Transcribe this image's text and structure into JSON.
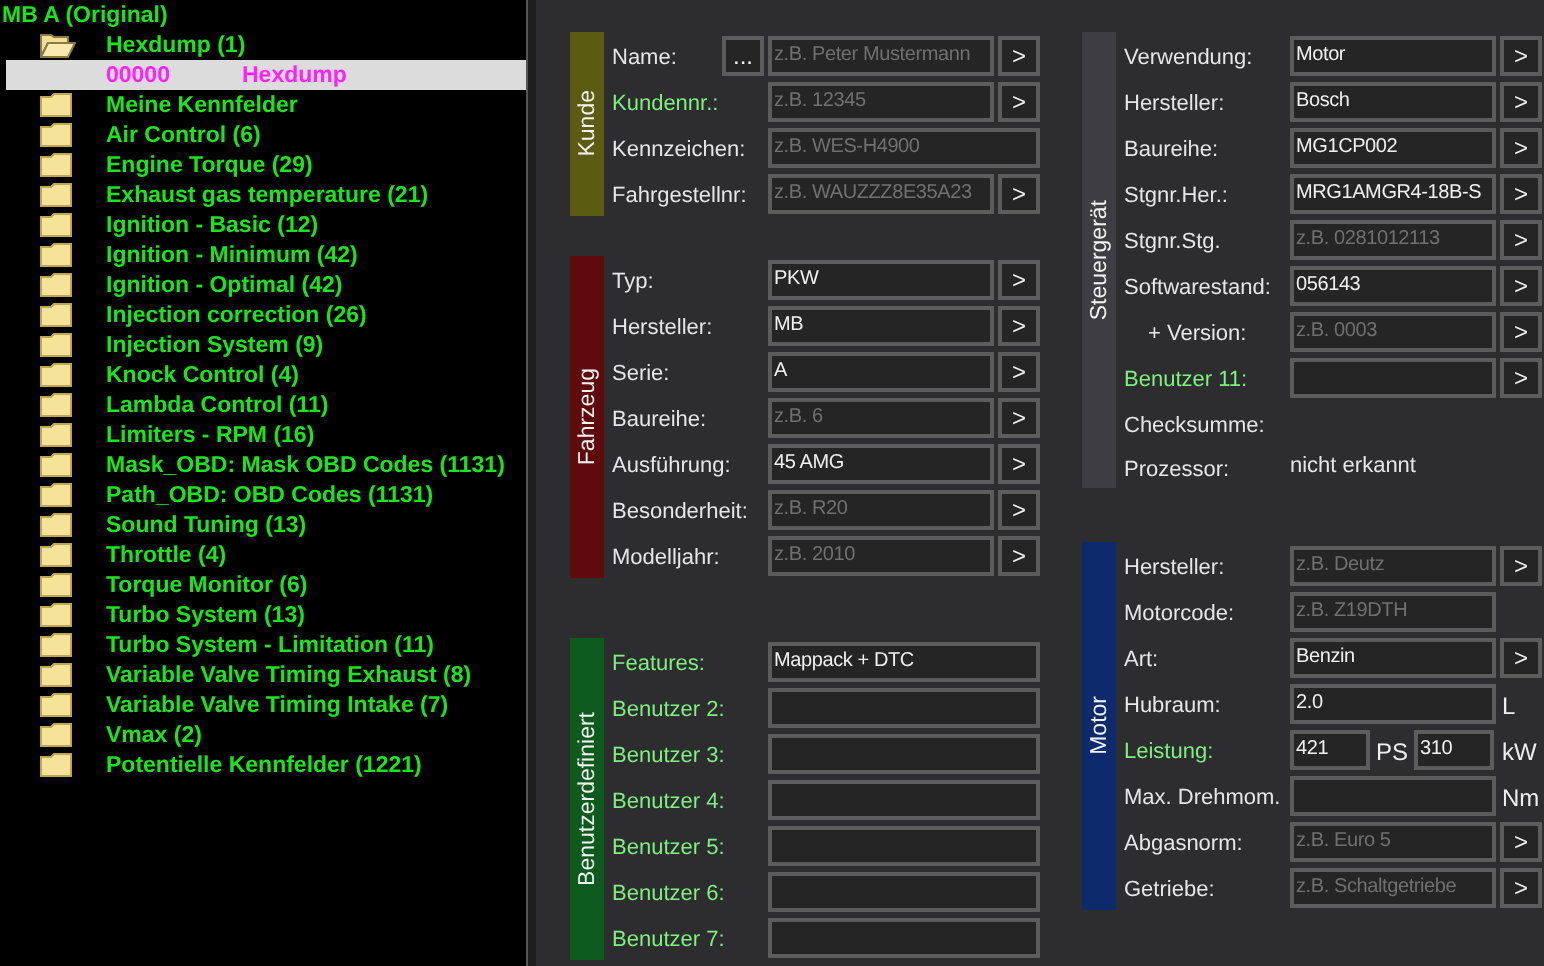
{
  "tree": {
    "label": "MB A (Original)",
    "children": [
      {
        "kind": "folder",
        "label": "Hexdump (1)",
        "expanded": true,
        "selected": false,
        "children": [
          {
            "kind": "entry",
            "code": "00000",
            "label": "Hexdump",
            "selected": true
          }
        ]
      },
      {
        "kind": "folder",
        "label": "Meine Kennfelder",
        "expanded": false,
        "selected": false
      },
      {
        "kind": "folder",
        "label": "Air Control (6)",
        "expanded": false,
        "selected": false
      },
      {
        "kind": "folder",
        "label": "Engine Torque (29)",
        "expanded": false,
        "selected": false
      },
      {
        "kind": "folder",
        "label": "Exhaust gas temperature (21)",
        "expanded": false,
        "selected": false
      },
      {
        "kind": "folder",
        "label": "Ignition - Basic (12)",
        "expanded": false,
        "selected": false
      },
      {
        "kind": "folder",
        "label": "Ignition - Minimum  (42)",
        "expanded": false,
        "selected": false
      },
      {
        "kind": "folder",
        "label": "Ignition - Optimal  (42)",
        "expanded": false,
        "selected": false
      },
      {
        "kind": "folder",
        "label": "Injection correction (26)",
        "expanded": false,
        "selected": false
      },
      {
        "kind": "folder",
        "label": "Injection System (9)",
        "expanded": false,
        "selected": false
      },
      {
        "kind": "folder",
        "label": "Knock Control (4)",
        "expanded": false,
        "selected": false
      },
      {
        "kind": "folder",
        "label": "Lambda Control (11)",
        "expanded": false,
        "selected": false
      },
      {
        "kind": "folder",
        "label": "Limiters - RPM  (16)",
        "expanded": false,
        "selected": false
      },
      {
        "kind": "folder",
        "label": "Mask_OBD: Mask OBD Codes (1131)",
        "expanded": false,
        "selected": false
      },
      {
        "kind": "folder",
        "label": "Path_OBD: OBD Codes (1131)",
        "expanded": false,
        "selected": false
      },
      {
        "kind": "folder",
        "label": "Sound Tuning (13)",
        "expanded": false,
        "selected": false
      },
      {
        "kind": "folder",
        "label": "Throttle  (4)",
        "expanded": false,
        "selected": false
      },
      {
        "kind": "folder",
        "label": "Torque Monitor  (6)",
        "expanded": false,
        "selected": false
      },
      {
        "kind": "folder",
        "label": "Turbo System (13)",
        "expanded": false,
        "selected": false
      },
      {
        "kind": "folder",
        "label": "Turbo System - Limitation (11)",
        "expanded": false,
        "selected": false
      },
      {
        "kind": "folder",
        "label": "Variable Valve Timing Exhaust (8)",
        "expanded": false,
        "selected": false
      },
      {
        "kind": "folder",
        "label": "Variable Valve Timing Intake (7)",
        "expanded": false,
        "selected": false
      },
      {
        "kind": "folder",
        "label": "Vmax (2)",
        "expanded": false,
        "selected": false
      },
      {
        "kind": "folder",
        "label": "Potentielle Kennfelder (1221)",
        "expanded": false,
        "selected": false
      }
    ]
  },
  "columns": [
    {
      "groups": [
        {
          "title": "Kunde",
          "color": "#5b5c12",
          "rows": [
            {
              "kind": "field",
              "label": "Name:",
              "highlighted": false,
              "pre_button": "...",
              "fields": [
                {
                  "placeholder": "z.B. Peter Mustermann"
                }
              ],
              "button": ">"
            },
            {
              "kind": "field",
              "label": "Kundennr.:",
              "highlighted": true,
              "fields": [
                {
                  "placeholder": "z.B. 12345"
                }
              ],
              "button": ">"
            },
            {
              "kind": "field",
              "label": "Kennzeichen:",
              "highlighted": false,
              "fields": [
                {
                  "placeholder": "z.B. WES-H4900"
                }
              ]
            },
            {
              "kind": "field",
              "label": "Fahrgestellnr:",
              "highlighted": false,
              "fields": [
                {
                  "placeholder": "z.B. WAUZZZ8E35A23"
                }
              ],
              "button": ">"
            }
          ]
        },
        {
          "title": "Fahrzeug",
          "color": "#5f0b0b",
          "rows": [
            {
              "kind": "field",
              "label": "Typ:",
              "highlighted": false,
              "fields": [
                {
                  "value": "PKW"
                }
              ],
              "button": ">"
            },
            {
              "kind": "field",
              "label": "Hersteller:",
              "highlighted": false,
              "fields": [
                {
                  "value": "MB"
                }
              ],
              "button": ">"
            },
            {
              "kind": "field",
              "label": "Serie:",
              "highlighted": false,
              "fields": [
                {
                  "value": "A"
                }
              ],
              "button": ">"
            },
            {
              "kind": "field",
              "label": "Baureihe:",
              "highlighted": false,
              "fields": [
                {
                  "placeholder": "z.B. 6"
                }
              ],
              "button": ">"
            },
            {
              "kind": "field",
              "label": "Ausführung:",
              "highlighted": false,
              "fields": [
                {
                  "value": "45 AMG"
                }
              ],
              "button": ">"
            },
            {
              "kind": "field",
              "label": "Besonderheit:",
              "highlighted": false,
              "fields": [
                {
                  "placeholder": "z.B. R20"
                }
              ],
              "button": ">"
            },
            {
              "kind": "field",
              "label": "Modelljahr:",
              "highlighted": false,
              "fields": [
                {
                  "placeholder": "z.B. 2010"
                }
              ],
              "button": ">"
            }
          ]
        },
        {
          "title": "Benutzerdefiniert",
          "color": "#0d5a1d",
          "rows": [
            {
              "kind": "field",
              "label": "Features:",
              "highlighted": true,
              "fields": [
                {
                  "value": "Mappack + DTC"
                }
              ]
            },
            {
              "kind": "field",
              "label": "Benutzer 2:",
              "highlighted": true
            },
            {
              "kind": "field",
              "label": "Benutzer 3:",
              "highlighted": true
            },
            {
              "kind": "field",
              "label": "Benutzer 4:",
              "highlighted": true
            },
            {
              "kind": "field",
              "label": "Benutzer 5:",
              "highlighted": true
            },
            {
              "kind": "field",
              "label": "Benutzer 6:",
              "highlighted": true
            },
            {
              "kind": "field",
              "label": "Benutzer 7:",
              "highlighted": true
            }
          ]
        }
      ]
    },
    {
      "groups": [
        {
          "title": "Steuergerät",
          "color": "#3e3e42",
          "rows": [
            {
              "kind": "field",
              "label": "Verwendung:",
              "highlighted": false,
              "fields": [
                {
                  "value": "Motor"
                }
              ],
              "button": ">"
            },
            {
              "kind": "field",
              "label": "Hersteller:",
              "highlighted": false,
              "fields": [
                {
                  "value": "Bosch"
                }
              ],
              "button": ">"
            },
            {
              "kind": "field",
              "label": "Baureihe:",
              "highlighted": false,
              "fields": [
                {
                  "value": "MG1CP002"
                }
              ],
              "button": ">"
            },
            {
              "kind": "field",
              "label": "Stgnr.Her.:",
              "highlighted": false,
              "fields": [
                {
                  "value": "MRG1AMGR4-18B-S"
                }
              ],
              "button": ">"
            },
            {
              "kind": "field",
              "label": "Stgnr.Stg.",
              "highlighted": false,
              "fields": [
                {
                  "placeholder": "z.B. 0281012113"
                }
              ],
              "button": ">"
            },
            {
              "kind": "field",
              "label": "Softwarestand:",
              "highlighted": false,
              "fields": [
                {
                  "value": "056143"
                }
              ],
              "button": ">"
            },
            {
              "kind": "field",
              "label": "+ Version:",
              "highlighted": false,
              "indented": true,
              "fields": [
                {
                  "placeholder": "z.B. 0003"
                }
              ],
              "button": ">"
            },
            {
              "kind": "field",
              "label": "Benutzer 11:",
              "highlighted": true,
              "button": ">"
            },
            {
              "kind": "text",
              "label": "Checksumme:",
              "highlighted": false
            },
            {
              "kind": "text",
              "label": "Prozessor:",
              "highlighted": false,
              "value": "nicht erkannt"
            }
          ]
        },
        {
          "title": "Motor",
          "color": "#0c2a6c",
          "rows": [
            {
              "kind": "field",
              "label": "Hersteller:",
              "highlighted": false,
              "fields": [
                {
                  "placeholder": "z.B. Deutz"
                }
              ],
              "button": ">"
            },
            {
              "kind": "field",
              "label": "Motorcode:",
              "highlighted": false,
              "fields": [
                {
                  "placeholder": "z.B. Z19DTH"
                }
              ]
            },
            {
              "kind": "field",
              "label": "Art:",
              "highlighted": false,
              "fields": [
                {
                  "value": "Benzin"
                }
              ],
              "button": ">"
            },
            {
              "kind": "field",
              "label": "Hubraum:",
              "highlighted": false,
              "fields": [
                {
                  "value": "2.0",
                  "unit": "L"
                }
              ]
            },
            {
              "kind": "field",
              "label": "Leistung:",
              "highlighted": true,
              "fields": [
                {
                  "value": "421",
                  "unit": "PS"
                },
                {
                  "value": "310",
                  "unit": "kW"
                }
              ]
            },
            {
              "kind": "field",
              "label": "Max. Drehmom.",
              "highlighted": false,
              "fields": [
                {
                  "unit": "Nm"
                }
              ]
            },
            {
              "kind": "field",
              "label": "Abgasnorm:",
              "highlighted": false,
              "fields": [
                {
                  "placeholder": "z.B. Euro 5"
                }
              ],
              "button": ">"
            },
            {
              "kind": "field",
              "label": "Getriebe:",
              "highlighted": false,
              "fields": [
                {
                  "placeholder": "z.B. Schaltgetriebe"
                }
              ],
              "button": ">"
            }
          ]
        }
      ]
    }
  ]
}
